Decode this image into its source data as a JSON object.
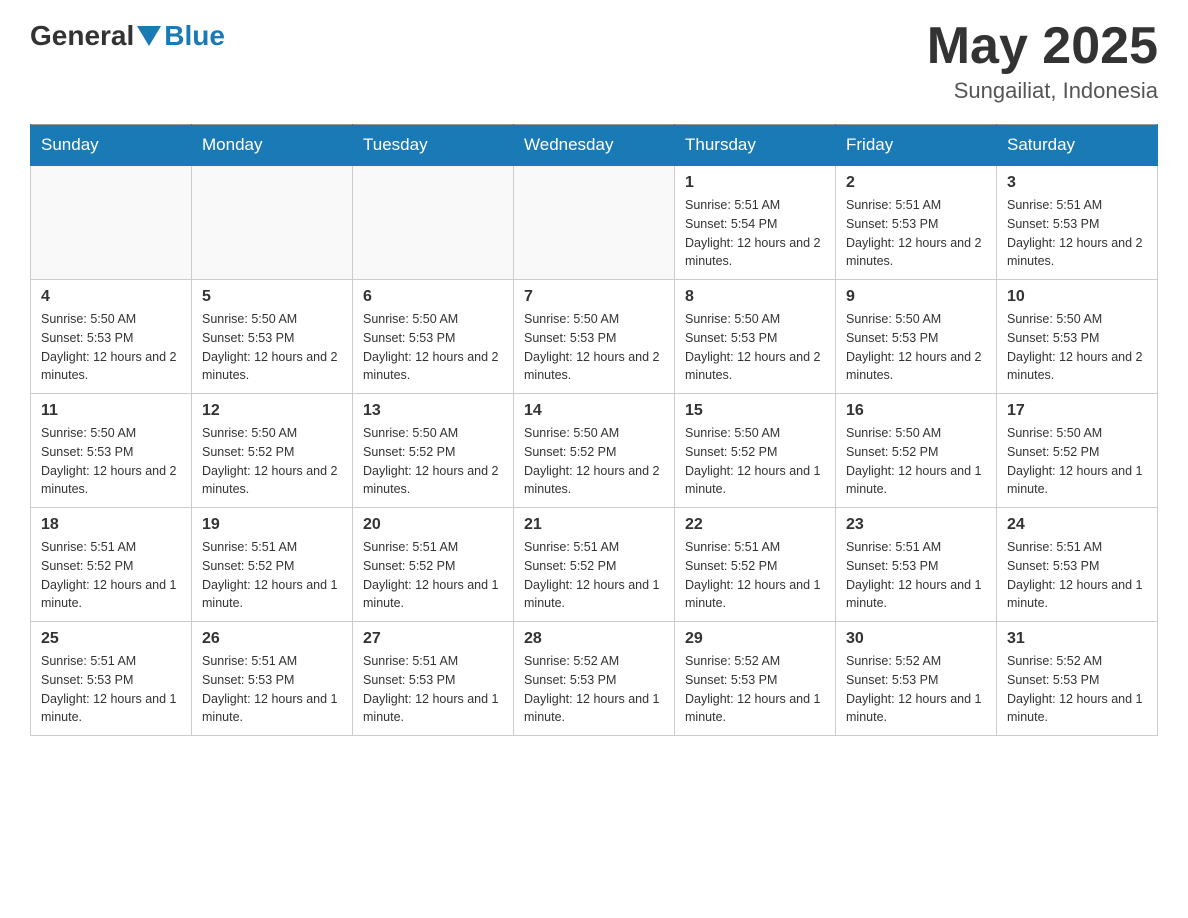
{
  "header": {
    "logo_general": "General",
    "logo_blue": "Blue",
    "month_year": "May 2025",
    "location": "Sungailiat, Indonesia"
  },
  "days_of_week": [
    "Sunday",
    "Monday",
    "Tuesday",
    "Wednesday",
    "Thursday",
    "Friday",
    "Saturday"
  ],
  "weeks": [
    {
      "days": [
        {
          "number": "",
          "info": ""
        },
        {
          "number": "",
          "info": ""
        },
        {
          "number": "",
          "info": ""
        },
        {
          "number": "",
          "info": ""
        },
        {
          "number": "1",
          "info": "Sunrise: 5:51 AM\nSunset: 5:54 PM\nDaylight: 12 hours and 2 minutes."
        },
        {
          "number": "2",
          "info": "Sunrise: 5:51 AM\nSunset: 5:53 PM\nDaylight: 12 hours and 2 minutes."
        },
        {
          "number": "3",
          "info": "Sunrise: 5:51 AM\nSunset: 5:53 PM\nDaylight: 12 hours and 2 minutes."
        }
      ]
    },
    {
      "days": [
        {
          "number": "4",
          "info": "Sunrise: 5:50 AM\nSunset: 5:53 PM\nDaylight: 12 hours and 2 minutes."
        },
        {
          "number": "5",
          "info": "Sunrise: 5:50 AM\nSunset: 5:53 PM\nDaylight: 12 hours and 2 minutes."
        },
        {
          "number": "6",
          "info": "Sunrise: 5:50 AM\nSunset: 5:53 PM\nDaylight: 12 hours and 2 minutes."
        },
        {
          "number": "7",
          "info": "Sunrise: 5:50 AM\nSunset: 5:53 PM\nDaylight: 12 hours and 2 minutes."
        },
        {
          "number": "8",
          "info": "Sunrise: 5:50 AM\nSunset: 5:53 PM\nDaylight: 12 hours and 2 minutes."
        },
        {
          "number": "9",
          "info": "Sunrise: 5:50 AM\nSunset: 5:53 PM\nDaylight: 12 hours and 2 minutes."
        },
        {
          "number": "10",
          "info": "Sunrise: 5:50 AM\nSunset: 5:53 PM\nDaylight: 12 hours and 2 minutes."
        }
      ]
    },
    {
      "days": [
        {
          "number": "11",
          "info": "Sunrise: 5:50 AM\nSunset: 5:53 PM\nDaylight: 12 hours and 2 minutes."
        },
        {
          "number": "12",
          "info": "Sunrise: 5:50 AM\nSunset: 5:52 PM\nDaylight: 12 hours and 2 minutes."
        },
        {
          "number": "13",
          "info": "Sunrise: 5:50 AM\nSunset: 5:52 PM\nDaylight: 12 hours and 2 minutes."
        },
        {
          "number": "14",
          "info": "Sunrise: 5:50 AM\nSunset: 5:52 PM\nDaylight: 12 hours and 2 minutes."
        },
        {
          "number": "15",
          "info": "Sunrise: 5:50 AM\nSunset: 5:52 PM\nDaylight: 12 hours and 1 minute."
        },
        {
          "number": "16",
          "info": "Sunrise: 5:50 AM\nSunset: 5:52 PM\nDaylight: 12 hours and 1 minute."
        },
        {
          "number": "17",
          "info": "Sunrise: 5:50 AM\nSunset: 5:52 PM\nDaylight: 12 hours and 1 minute."
        }
      ]
    },
    {
      "days": [
        {
          "number": "18",
          "info": "Sunrise: 5:51 AM\nSunset: 5:52 PM\nDaylight: 12 hours and 1 minute."
        },
        {
          "number": "19",
          "info": "Sunrise: 5:51 AM\nSunset: 5:52 PM\nDaylight: 12 hours and 1 minute."
        },
        {
          "number": "20",
          "info": "Sunrise: 5:51 AM\nSunset: 5:52 PM\nDaylight: 12 hours and 1 minute."
        },
        {
          "number": "21",
          "info": "Sunrise: 5:51 AM\nSunset: 5:52 PM\nDaylight: 12 hours and 1 minute."
        },
        {
          "number": "22",
          "info": "Sunrise: 5:51 AM\nSunset: 5:52 PM\nDaylight: 12 hours and 1 minute."
        },
        {
          "number": "23",
          "info": "Sunrise: 5:51 AM\nSunset: 5:53 PM\nDaylight: 12 hours and 1 minute."
        },
        {
          "number": "24",
          "info": "Sunrise: 5:51 AM\nSunset: 5:53 PM\nDaylight: 12 hours and 1 minute."
        }
      ]
    },
    {
      "days": [
        {
          "number": "25",
          "info": "Sunrise: 5:51 AM\nSunset: 5:53 PM\nDaylight: 12 hours and 1 minute."
        },
        {
          "number": "26",
          "info": "Sunrise: 5:51 AM\nSunset: 5:53 PM\nDaylight: 12 hours and 1 minute."
        },
        {
          "number": "27",
          "info": "Sunrise: 5:51 AM\nSunset: 5:53 PM\nDaylight: 12 hours and 1 minute."
        },
        {
          "number": "28",
          "info": "Sunrise: 5:52 AM\nSunset: 5:53 PM\nDaylight: 12 hours and 1 minute."
        },
        {
          "number": "29",
          "info": "Sunrise: 5:52 AM\nSunset: 5:53 PM\nDaylight: 12 hours and 1 minute."
        },
        {
          "number": "30",
          "info": "Sunrise: 5:52 AM\nSunset: 5:53 PM\nDaylight: 12 hours and 1 minute."
        },
        {
          "number": "31",
          "info": "Sunrise: 5:52 AM\nSunset: 5:53 PM\nDaylight: 12 hours and 1 minute."
        }
      ]
    }
  ]
}
